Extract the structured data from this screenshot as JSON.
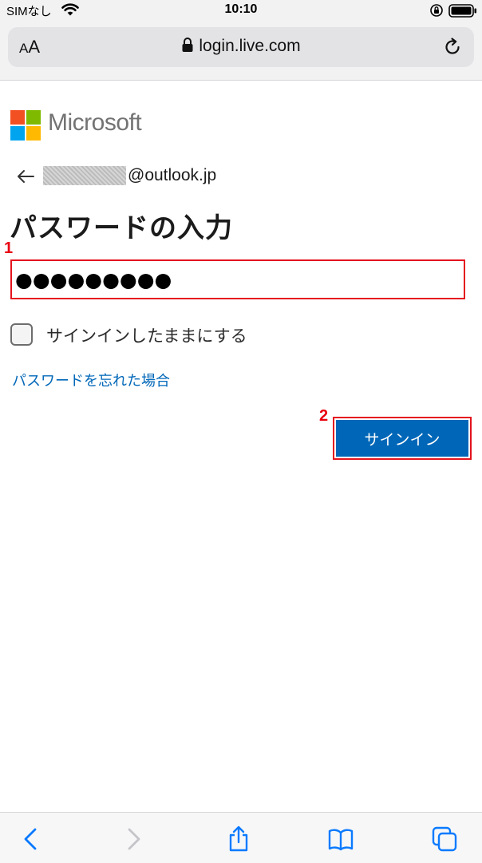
{
  "status_bar": {
    "carrier": "SIMなし",
    "time": "10:10"
  },
  "browser": {
    "reader_label_big": "A",
    "reader_label_small": "A",
    "url": "login.live.com"
  },
  "brand": {
    "name": "Microsoft",
    "logo_colors": [
      "#f25022",
      "#7fba00",
      "#00a4ef",
      "#ffb900"
    ]
  },
  "identity": {
    "email_domain": "@outlook.jp"
  },
  "login": {
    "title": "パスワードの入力",
    "password_mask": "●●●●●●●●●",
    "keep_signed_in_label": "サインインしたままにする",
    "forgot_password_link": "パスワードを忘れた場合",
    "signin_button": "サインイン"
  },
  "annotations": {
    "step1": "1",
    "step2": "2",
    "highlight_color": "#e4141e"
  },
  "toolbar": {
    "icons": [
      "back-icon",
      "forward-icon",
      "share-icon",
      "bookmarks-icon",
      "tabs-icon"
    ],
    "accent_color": "#0a7aff",
    "disabled_color": "#c5c5c9"
  }
}
